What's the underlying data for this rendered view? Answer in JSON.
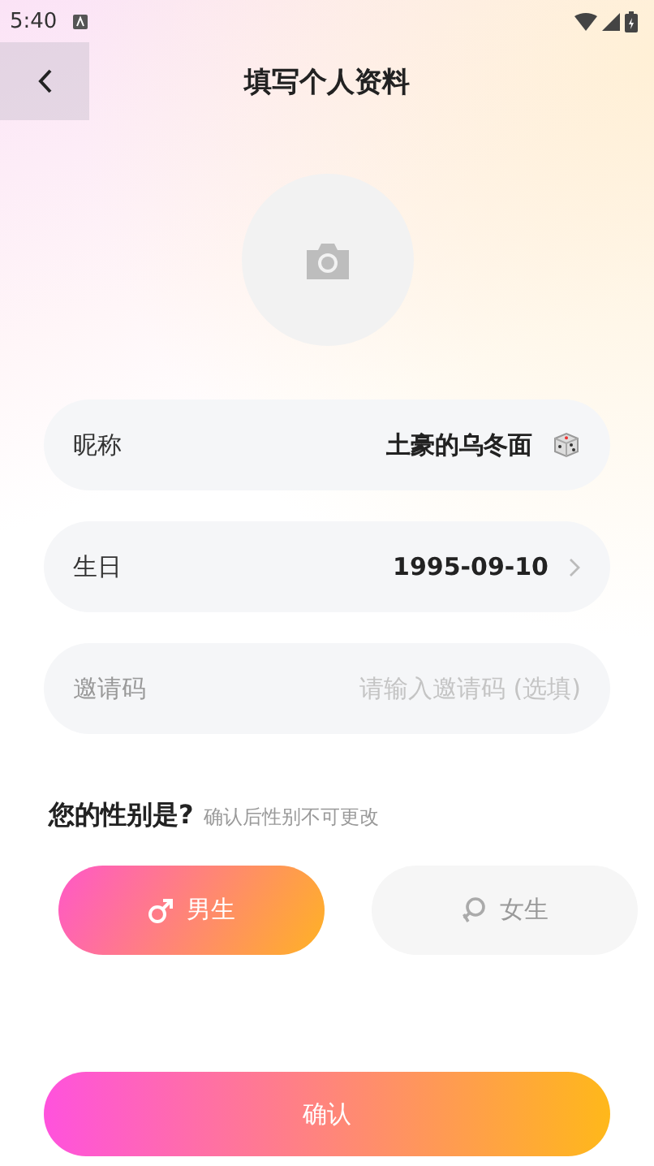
{
  "status_bar": {
    "time": "5:40"
  },
  "header": {
    "title": "填写个人资料"
  },
  "fields": [
    {
      "kind": "text",
      "label": "昵称",
      "value": "土豪的乌冬面"
    },
    {
      "kind": "select",
      "label": "生日",
      "value": "1995-09-10"
    },
    {
      "kind": "input",
      "label": "邀请码",
      "placeholder": "请输入邀请码 (选填)"
    }
  ],
  "gender": {
    "title": "您的性别是?",
    "hint": "确认后性别不可更改",
    "options": [
      {
        "kind": "male",
        "label": "男生",
        "selected": true
      },
      {
        "kind": "female",
        "label": "女生",
        "selected": false
      }
    ]
  },
  "confirm_button": {
    "label": "确认"
  }
}
